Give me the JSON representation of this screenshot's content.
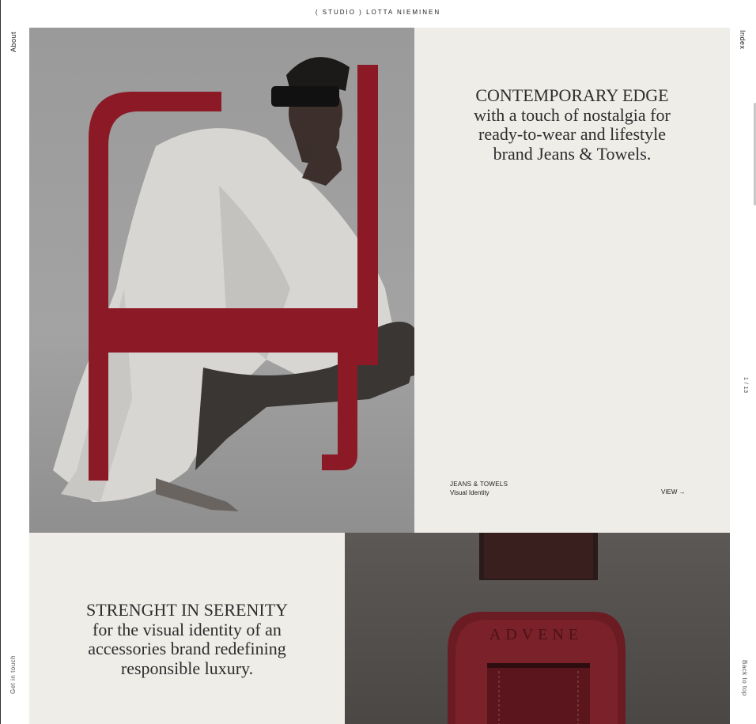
{
  "header": {
    "studio_label": "( STUDIO )  LOTTA  NIEMINEN"
  },
  "nav": {
    "about": "About",
    "index": "Index",
    "get_in_touch": "Get in touch",
    "back_to_top": "Back to top",
    "counter": "1 / 13"
  },
  "project1": {
    "headline_line1": "CONTEMPORARY EDGE",
    "headline_line2": "with a touch of nostalgia for",
    "headline_line3": "ready-to-wear and lifestyle",
    "headline_line4": "brand Jeans & Towels.",
    "caption_title": "JEANS & TOWELS",
    "caption_subtitle": "Visual Identity",
    "view_label": "VIEW  →",
    "accent_color": "#8b1a26"
  },
  "project2": {
    "headline_line1": "STRENGHT IN SERENITY",
    "headline_line2": "for the visual identity of an",
    "headline_line3": "accessories brand redefining",
    "headline_line4": "responsible luxury.",
    "embossed_brand": "ADVENE",
    "leather_color": "#6b1c22"
  }
}
